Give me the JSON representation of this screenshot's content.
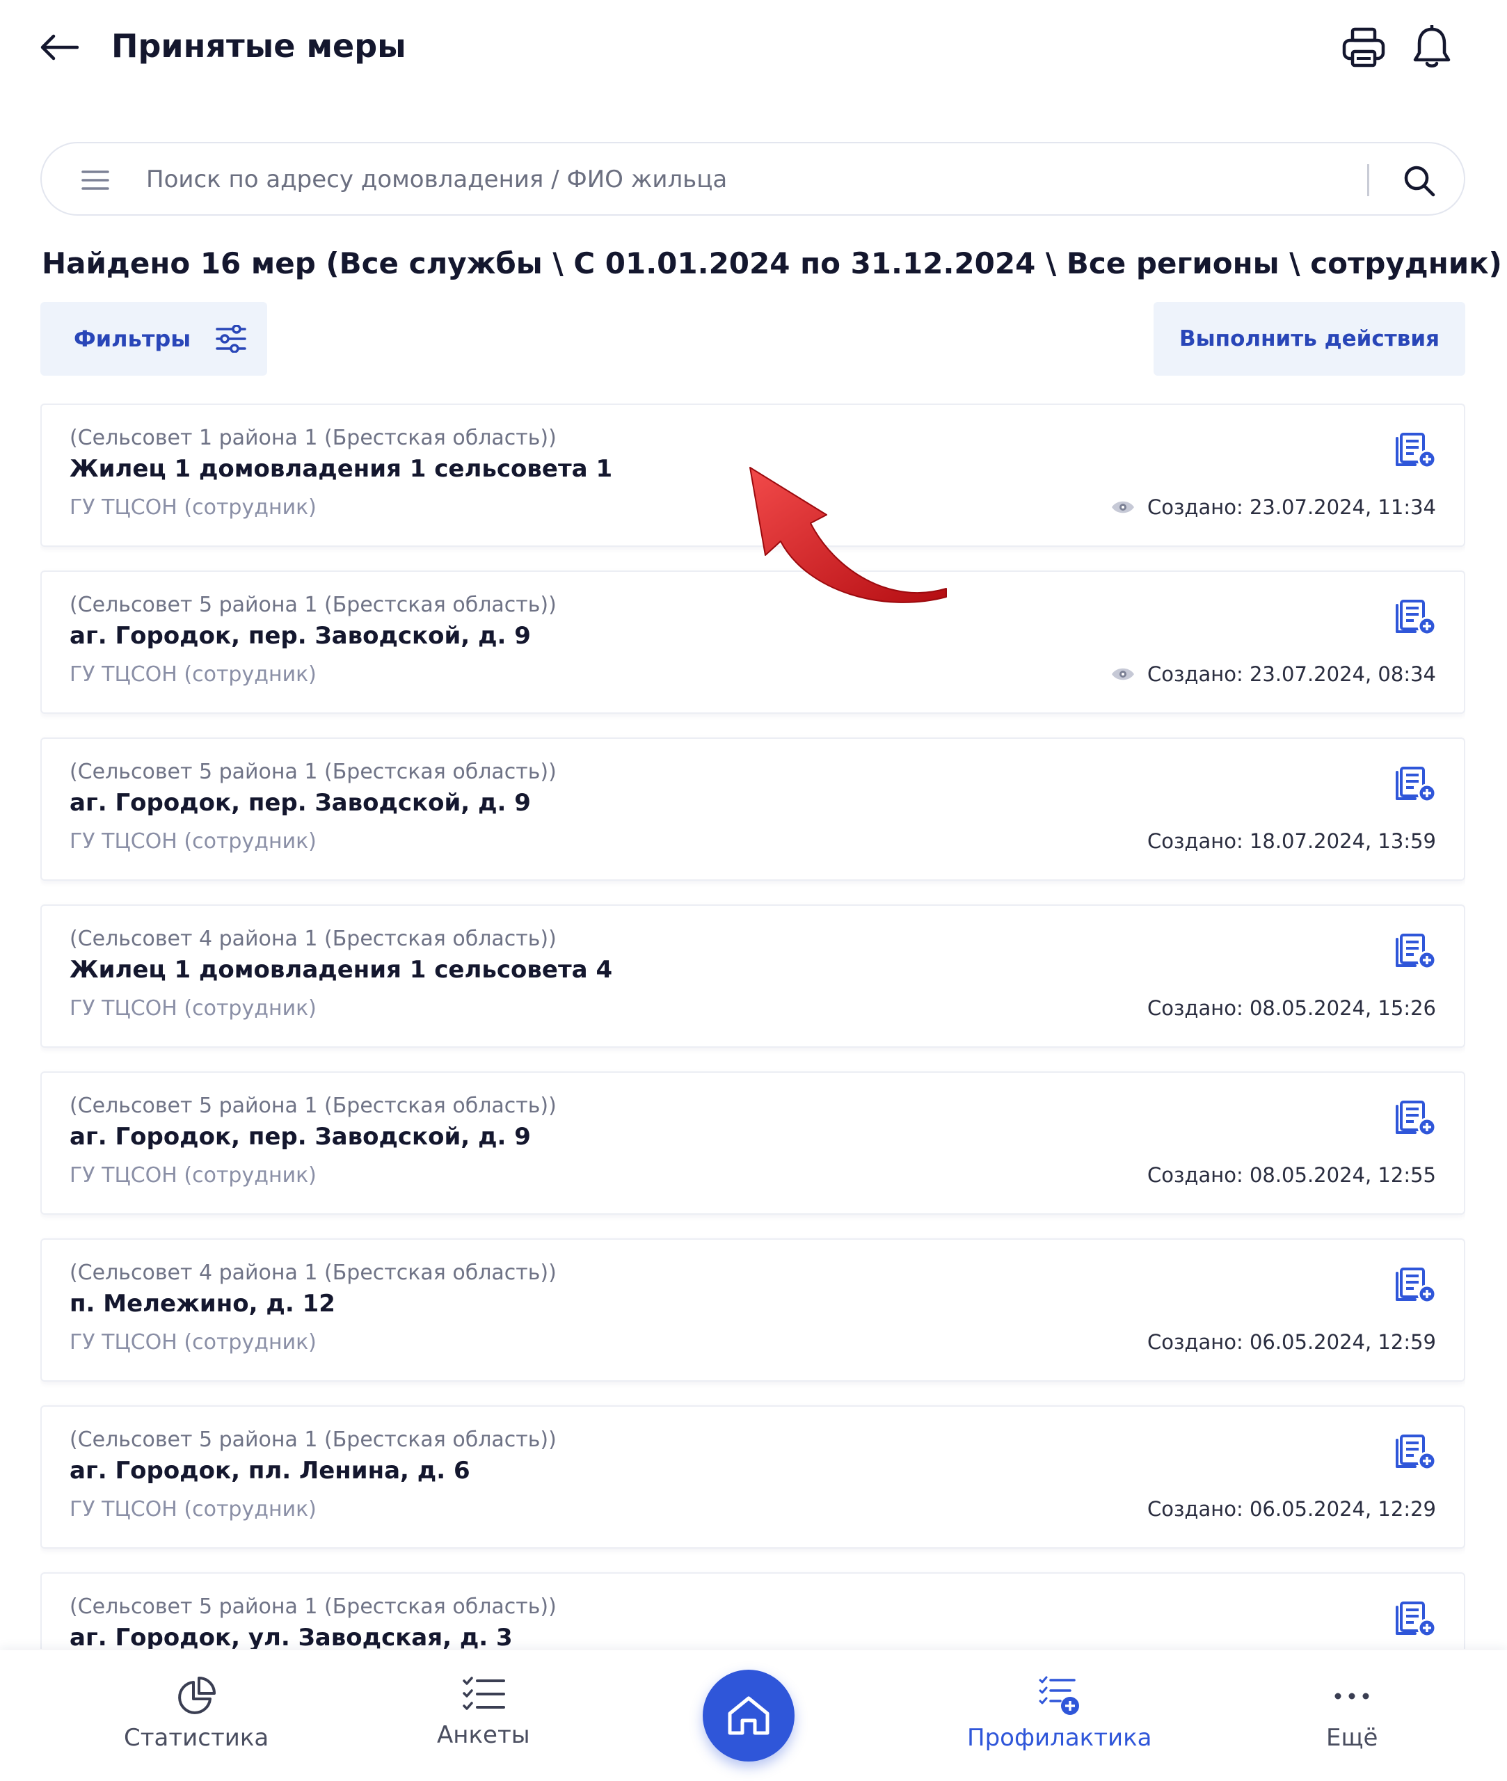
{
  "header": {
    "title": "Принятые меры",
    "back_icon": "arrow-left-icon",
    "print_icon": "printer-icon",
    "bell_icon": "bell-icon"
  },
  "search": {
    "placeholder": "Поиск по адресу домовладения / ФИО жильца",
    "value": ""
  },
  "result_summary": "Найдено 16 мер (Все службы \\ С 01.01.2024 по 31.12.2024 \\ Все регионы \\ сотрудник)",
  "buttons": {
    "filters": "Фильтры",
    "actions": "Выполнить действия"
  },
  "colors": {
    "accent": "#2f56d9",
    "button_bg": "#eef3fb",
    "arrow": "#d3161c"
  },
  "cards": [
    {
      "region": "(Сельсовет 1 района 1 (Брестская область))",
      "address": "Жилец 1 домовладения 1 сельсовета 1",
      "org": "ГУ ТЦСОН (сотрудник)",
      "created": "Создано: 23.07.2024, 11:34",
      "viewed": true
    },
    {
      "region": "(Сельсовет 5 района 1 (Брестская область))",
      "address": "аг. Городок, пер. Заводской, д. 9",
      "org": "ГУ ТЦСОН (сотрудник)",
      "created": "Создано: 23.07.2024, 08:34",
      "viewed": true
    },
    {
      "region": "(Сельсовет 5 района 1 (Брестская область))",
      "address": "аг. Городок, пер. Заводской, д. 9",
      "org": "ГУ ТЦСОН (сотрудник)",
      "created": "Создано: 18.07.2024, 13:59",
      "viewed": false
    },
    {
      "region": "(Сельсовет 4 района 1 (Брестская область))",
      "address": "Жилец 1 домовладения 1 сельсовета 4",
      "org": "ГУ ТЦСОН (сотрудник)",
      "created": "Создано: 08.05.2024, 15:26",
      "viewed": false
    },
    {
      "region": "(Сельсовет 5 района 1 (Брестская область))",
      "address": "аг. Городок, пер. Заводской, д. 9",
      "org": "ГУ ТЦСОН (сотрудник)",
      "created": "Создано: 08.05.2024, 12:55",
      "viewed": false
    },
    {
      "region": "(Сельсовет 4 района 1 (Брестская область))",
      "address": "п. Мележино, д. 12",
      "org": "ГУ ТЦСОН (сотрудник)",
      "created": "Создано: 06.05.2024, 12:59",
      "viewed": false
    },
    {
      "region": "(Сельсовет 5 района 1 (Брестская область))",
      "address": "аг. Городок, пл. Ленина, д. 6",
      "org": "ГУ ТЦСОН (сотрудник)",
      "created": "Создано: 06.05.2024, 12:29",
      "viewed": false
    },
    {
      "region": "(Сельсовет 5 района 1 (Брестская область))",
      "address": "аг. Городок, ул. Заводская, д. 3",
      "org": "",
      "created": "",
      "viewed": false
    }
  ],
  "bottom_nav": {
    "statistics": "Статистика",
    "surveys": "Анкеты",
    "home_icon": "home-icon",
    "prevention": "Профилактика",
    "more": "Ещё",
    "active": "prevention"
  }
}
